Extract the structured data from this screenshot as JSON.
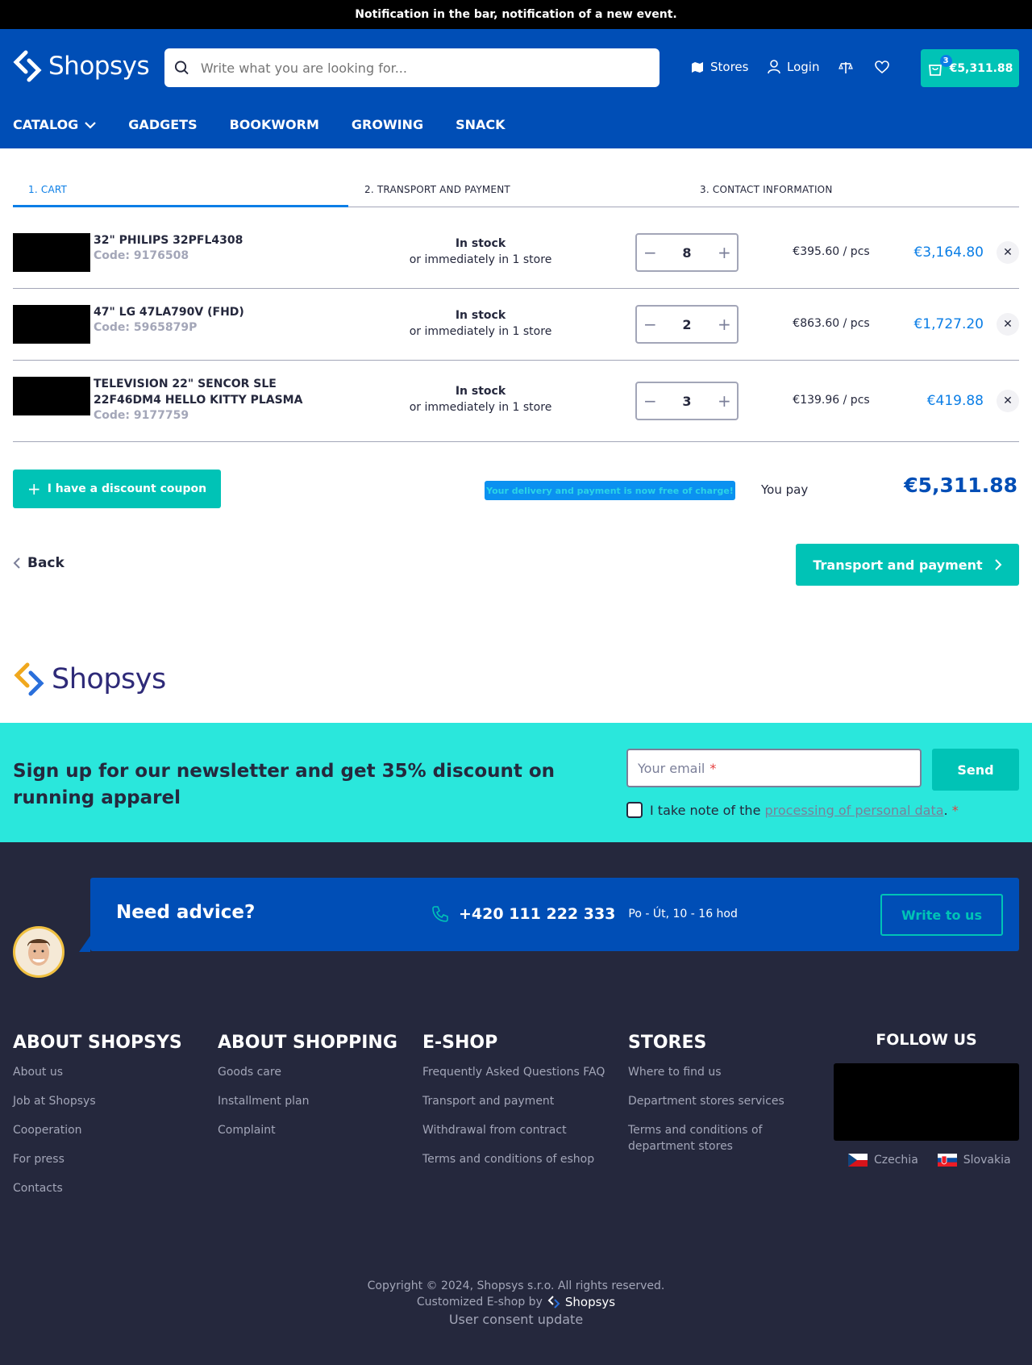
{
  "notification": "Notification in the bar, notification of a new event.",
  "header": {
    "logo": "Shopsys",
    "search_placeholder": "Write what you are looking for...",
    "stores": "Stores",
    "login": "Login",
    "cart_count": "3",
    "cart_total": "€5,311.88"
  },
  "nav": [
    "CATALOG",
    "GADGETS",
    "BOOKWORM",
    "GROWING",
    "SNACK"
  ],
  "steps": [
    "1. CART",
    "2. TRANSPORT AND PAYMENT",
    "3. CONTACT INFORMATION"
  ],
  "items": [
    {
      "name1": "32\" PHILIPS 32PFL4308",
      "name2": "",
      "code": "Code: 9176508",
      "stock": "In stock",
      "store": "or immediately in 1 store",
      "qty": "8",
      "unit": "€395.60 / pcs",
      "total": "€3,164.80"
    },
    {
      "name1": "47\" LG 47LA790V (FHD)",
      "name2": "",
      "code": "Code: 5965879P",
      "stock": "In stock",
      "store": "or immediately in 1 store",
      "qty": "2",
      "unit": "€863.60 / pcs",
      "total": "€1,727.20"
    },
    {
      "name1": "TELEVISION 22\" SENCOR SLE",
      "name2": "22F46DM4 HELLO KITTY PLASMA",
      "code": "Code: 9177759",
      "stock": "In stock",
      "store": "or immediately in 1 store",
      "qty": "3",
      "unit": "€139.96 / pcs",
      "total": "€419.88"
    }
  ],
  "coupon": "I have a discount coupon",
  "free_delivery": "Your delivery and payment is now free of charge!",
  "you_pay": "You pay",
  "grand_total": "€5,311.88",
  "back": "Back",
  "next": "Transport and payment",
  "newsletter": {
    "title": "Sign up for our newsletter and get 35% discount on running apparel",
    "email_placeholder": "Your email",
    "required": "*",
    "send": "Send",
    "consent_prefix": "I take note of the",
    "consent_link": "processing of personal data",
    "consent_suffix": "."
  },
  "advice": {
    "title": "Need advice?",
    "phone": "+420 111 222 333",
    "hours": "Po - Út, 10 - 16 hod",
    "write": "Write to us"
  },
  "footer": {
    "cols": [
      {
        "title": "ABOUT SHOPSYS",
        "links": [
          "About us",
          "Job at Shopsys",
          "Cooperation",
          "For press",
          "Contacts"
        ]
      },
      {
        "title": "ABOUT SHOPPING",
        "links": [
          "Goods care",
          "Installment plan",
          "Complaint"
        ]
      },
      {
        "title": "E-SHOP",
        "links": [
          "Frequently Asked Questions FAQ",
          "Transport and payment",
          "Withdrawal from contract",
          "Terms and conditions of eshop"
        ]
      },
      {
        "title": "STORES",
        "links": [
          "Where to find us",
          "Department stores services",
          "Terms and conditions of department stores"
        ]
      }
    ],
    "follow": "FOLLOW US",
    "langs": [
      "Czechia",
      "Slovakia"
    ],
    "copyright": "Copyright © 2024, Shopsys s.r.o. All rights reserved.",
    "customized": "Customized E-shop by",
    "brand": "Shopsys",
    "consent_update": "User consent update"
  },
  "colors": {
    "primary": "#004eb6",
    "accent": "#00c3b6",
    "link": "#0b7ee6",
    "footer": "#25283d",
    "newsletter": "#2ae7dc"
  }
}
